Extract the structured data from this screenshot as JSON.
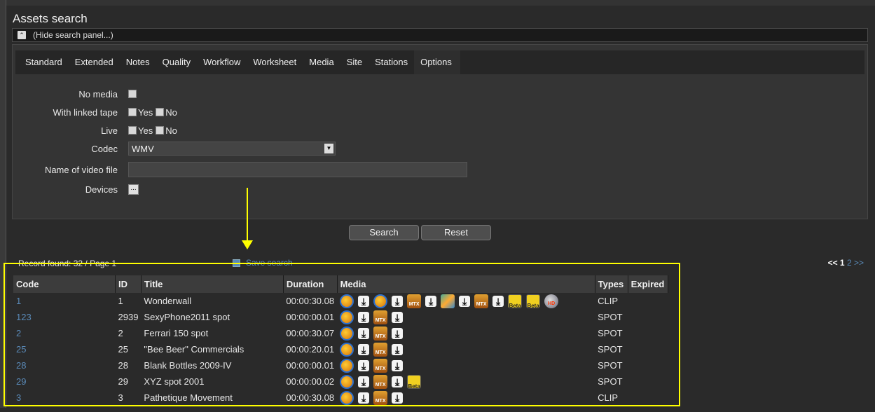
{
  "page": {
    "title": "Assets search"
  },
  "hide_panel": {
    "label": "(Hide search panel...)"
  },
  "tabs": [
    "Standard",
    "Extended",
    "Notes",
    "Quality",
    "Workflow",
    "Worksheet",
    "Media",
    "Site",
    "Stations",
    "Options"
  ],
  "form": {
    "no_media_label": "No media",
    "linked_tape_label": "With linked tape",
    "live_label": "Live",
    "yes": "Yes",
    "no": "No",
    "codec_label": "Codec",
    "codec_value": "WMV",
    "video_file_label": "Name of video file",
    "video_file_value": "",
    "devices_label": "Devices",
    "devices_button": "..."
  },
  "actions": {
    "search": "Search",
    "reset": "Reset"
  },
  "results": {
    "records_found": "Record found: 32 / Page 1",
    "save_search": "Save search",
    "pager_prev": "<<",
    "pager_current": "1",
    "pager_next_page": "2",
    "pager_next": ">>"
  },
  "table": {
    "headers": [
      "Code",
      "ID",
      "Title",
      "Duration",
      "Media",
      "Types",
      "Expired"
    ],
    "rows": [
      {
        "code": "1",
        "id": "1",
        "title": "Wonderwall",
        "duration": "00:00:30.08",
        "media": [
          "play",
          "download",
          "play",
          "download",
          "mtx",
          "download",
          "animation",
          "download",
          "mtx",
          "download",
          "beta",
          "beta",
          "hd"
        ],
        "type": "CLIP",
        "expired": ""
      },
      {
        "code": "123",
        "id": "2939",
        "title": "SexyPhone2011 spot",
        "duration": "00:00:00.01",
        "media": [
          "play",
          "download",
          "mtx",
          "download"
        ],
        "type": "SPOT",
        "expired": ""
      },
      {
        "code": "2",
        "id": "2",
        "title": "Ferrari 150 spot",
        "duration": "00:00:30.07",
        "media": [
          "play",
          "download",
          "mtx",
          "download"
        ],
        "type": "SPOT",
        "expired": ""
      },
      {
        "code": "25",
        "id": "25",
        "title": "\"Bee Beer\" Commercials",
        "duration": "00:00:20.01",
        "media": [
          "play",
          "download",
          "mtx",
          "download"
        ],
        "type": "SPOT",
        "expired": ""
      },
      {
        "code": "28",
        "id": "28",
        "title": "Blank Bottles 2009-IV",
        "duration": "00:00:00.01",
        "media": [
          "play",
          "download",
          "mtx",
          "download"
        ],
        "type": "SPOT",
        "expired": ""
      },
      {
        "code": "29",
        "id": "29",
        "title": "XYZ spot 2001",
        "duration": "00:00:00.02",
        "media": [
          "play",
          "download",
          "mtx",
          "download",
          "beta"
        ],
        "type": "SPOT",
        "expired": ""
      },
      {
        "code": "3",
        "id": "3",
        "title": "Pathetique Movement",
        "duration": "00:00:30.08",
        "media": [
          "play",
          "download",
          "mtx",
          "download"
        ],
        "type": "CLIP",
        "expired": ""
      }
    ]
  },
  "media_labels": {
    "mtx": "MTX",
    "beta": "Beta",
    "hd": "HD",
    "download": "⤓"
  },
  "colors": {
    "accent_link": "#5a8ab8",
    "highlight": "#ffff00",
    "background": "#2a2a2a"
  }
}
